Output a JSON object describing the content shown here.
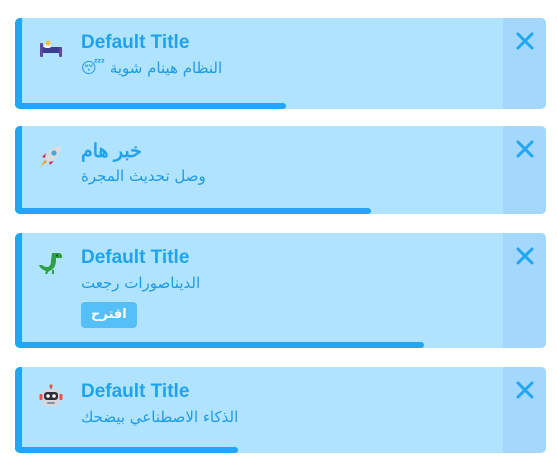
{
  "colors": {
    "toast_bg": "#b0e3fd",
    "accent": "#21a6f4",
    "close_zone": "#a3d7fb",
    "text": "#1fa3ef",
    "button_bg": "#55c0f8"
  },
  "toasts": [
    {
      "icon": "bed-icon",
      "title": "Default Title",
      "message": "النظام هينام شوية 😴",
      "progress": 0.51
    },
    {
      "icon": "rocket-icon",
      "title": "خبر هام",
      "message": "وصل تحديث المجرة",
      "progress": 0.67
    },
    {
      "icon": "dinosaur-icon",
      "title": "Default Title",
      "message": "الديناصورات رجعت",
      "button": "اقترح",
      "progress": 0.77
    },
    {
      "icon": "robot-icon",
      "title": "Default Title",
      "message": "الذكاء الاصطناعي بيضحك",
      "progress": 0.42
    }
  ]
}
